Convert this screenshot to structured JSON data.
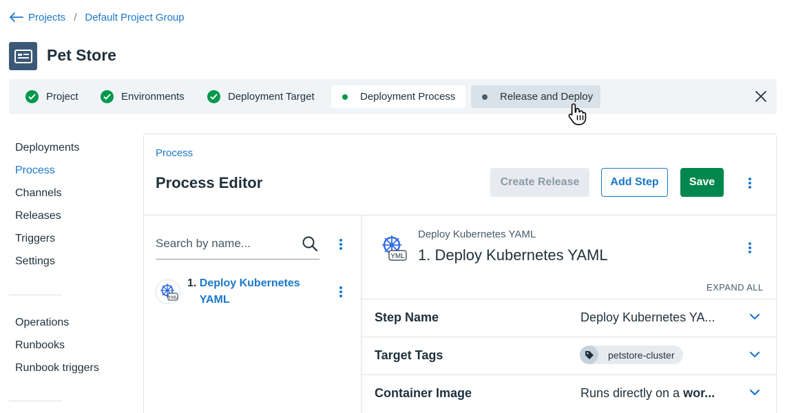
{
  "breadcrumb": {
    "projects": "Projects",
    "separator": "/",
    "group": "Default Project Group"
  },
  "project": {
    "name": "Pet Store"
  },
  "onboarding_steps": [
    {
      "label": "Project",
      "state": "complete"
    },
    {
      "label": "Environments",
      "state": "complete"
    },
    {
      "label": "Deployment Target",
      "state": "complete"
    },
    {
      "label": "Deployment Process",
      "state": "current"
    },
    {
      "label": "Release and Deploy",
      "state": "pending"
    }
  ],
  "sidebar": {
    "items": [
      "Deployments",
      "Process",
      "Channels",
      "Releases",
      "Triggers",
      "Settings"
    ],
    "selected": "Process",
    "operations": [
      "Operations",
      "Runbooks",
      "Runbook triggers"
    ]
  },
  "editor": {
    "breadcrumb": "Process",
    "title": "Process Editor",
    "buttons": {
      "create_release": "Create Release",
      "add_step": "Add Step",
      "save": "Save"
    }
  },
  "step_list": {
    "search_placeholder": "Search by name...",
    "steps": [
      {
        "number": "1.",
        "name": "Deploy Kubernetes YAML"
      }
    ]
  },
  "step_detail": {
    "template": "Deploy Kubernetes YAML",
    "title": "1. Deploy Kubernetes YAML",
    "expand_all": "EXPAND ALL",
    "icon_badge": "YML",
    "rows": {
      "step_name": {
        "label": "Step Name",
        "value": "Deploy Kubernetes YA..."
      },
      "target_tags": {
        "label": "Target Tags",
        "tag": "petstore-cluster"
      },
      "container_image": {
        "label": "Container Image",
        "value_prefix": "Runs directly on a ",
        "value_bold": "wor..."
      }
    }
  },
  "colors": {
    "accent": "#1a77ca",
    "success": "#00984b",
    "primary_button": "#00874d",
    "project_logo": "#3b5977"
  }
}
